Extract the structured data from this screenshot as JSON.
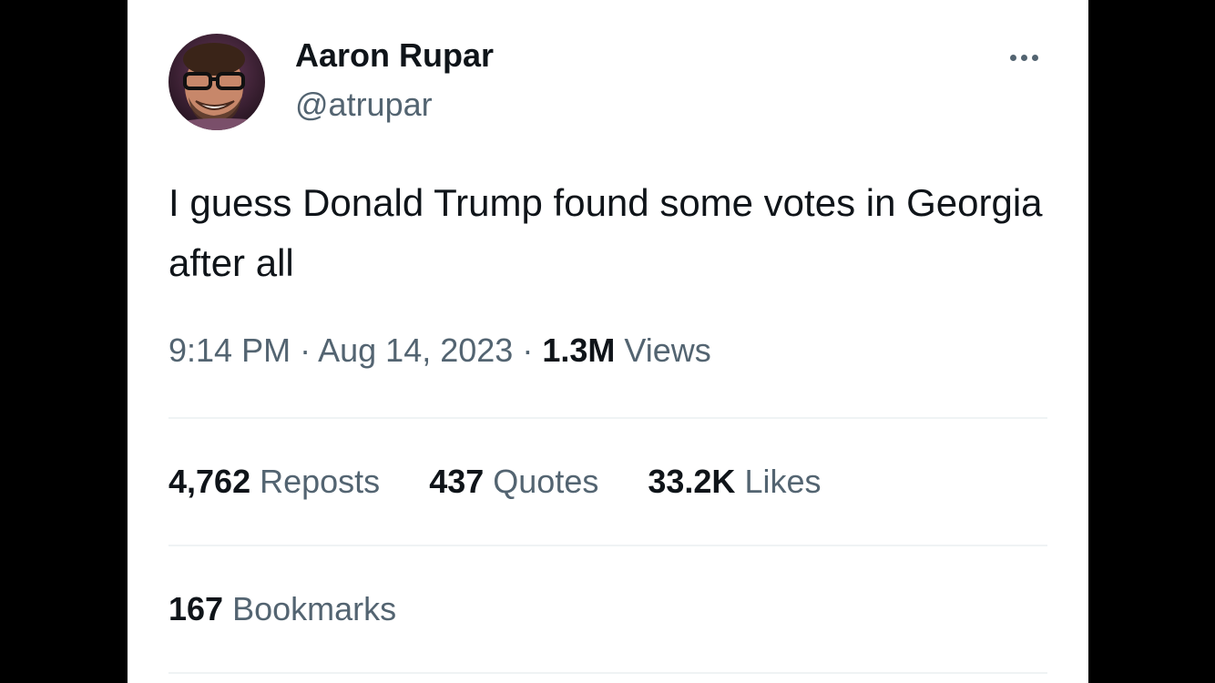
{
  "tweet": {
    "author_name": "Aaron Rupar",
    "author_handle": "@atrupar",
    "text": "I guess Donald Trump found some votes in Georgia after all",
    "time": "9:14 PM",
    "separator": "·",
    "date": "Aug 14, 2023",
    "views_count": "1.3M",
    "views_label": "Views"
  },
  "stats": {
    "reposts_count": "4,762",
    "reposts_label": "Reposts",
    "quotes_count": "437",
    "quotes_label": "Quotes",
    "likes_count": "33.2K",
    "likes_label": "Likes",
    "bookmarks_count": "167",
    "bookmarks_label": "Bookmarks"
  },
  "icons": {
    "more": "more-horizontal-icon"
  },
  "colors": {
    "text_primary": "#0f1419",
    "text_secondary": "#536471",
    "divider": "#eff3f4",
    "background": "#ffffff",
    "letterbox": "#000000"
  }
}
